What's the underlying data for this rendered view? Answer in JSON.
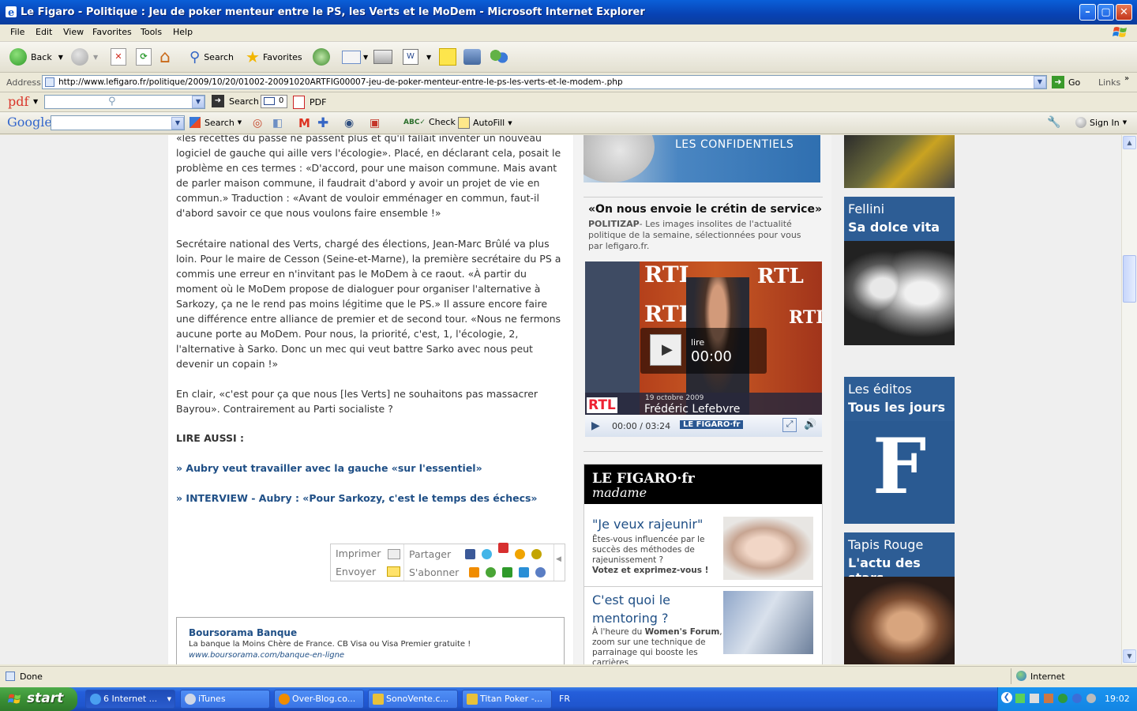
{
  "window": {
    "title": "Le Figaro - Politique : Jeu de poker menteur entre le PS, les Verts et le MoDem - Microsoft Internet Explorer"
  },
  "menu": [
    "File",
    "Edit",
    "View",
    "Favorites",
    "Tools",
    "Help"
  ],
  "toolbar": {
    "back": "Back",
    "search": "Search",
    "favorites": "Favorites"
  },
  "address": {
    "label": "Address",
    "url": "http://www.lefigaro.fr/politique/2009/10/20/01002-20091020ARTFIG00007-jeu-de-poker-menteur-entre-le-ps-les-verts-et-le-modem-.php",
    "go": "Go",
    "links": "Links"
  },
  "pdfbar": {
    "logo": "pdf",
    "search": "Search",
    "count": "0",
    "pdf": "PDF"
  },
  "googlebar": {
    "logo": "Google",
    "search": "Search",
    "check": "Check",
    "autofill": "AutoFill",
    "signin": "Sign In"
  },
  "article": {
    "p1": "«les recettes du passé ne passent plus et qu'il fallait inventer un nouveau logiciel de gauche qui aille vers l'écologie». Placé, en déclarant cela, posait le problème en ces termes : «D'accord, pour une maison commune. Mais avant de parler maison commune, il faudrait d'abord y avoir un projet de vie en commun.» Traduction : «Avant de vouloir emménager en commun, faut-il d'abord savoir ce que nous voulons faire ensemble !»",
    "p2": "Secrétaire national des Verts, chargé des élections, Jean-Marc Brûlé va plus loin. Pour le maire de Cesson (Seine-et-Marne), la première secrétaire du PS a commis une erreur en n'invitant pas le MoDem à ce raout. «À partir du moment où le MoDem propose de dialoguer pour organiser l'alternative à Sarkozy, ça ne le rend pas moins légitime que le PS.» Il assure encore faire une différence entre alliance de premier et de second tour. «Nous ne fermons aucune porte au MoDem. Pour nous, la priorité, c'est, 1, l'écologie, 2, l'alternative à Sarko. Donc un mec qui veut battre Sarko avec nous peut devenir un copain !»",
    "p3": "En clair, «c'est pour ça que nous [les Verts] ne souhaitons pas massacrer Bayrou». Contrairement au Parti socialiste ?",
    "lire_aussi": "LIRE AUSSI :",
    "link1": "» Aubry veut travailler avec la gauche «sur l'essentiel»",
    "link2": "» INTERVIEW - Aubry : «Pour Sarkozy, c'est le temps des échecs»",
    "share": {
      "imprimer": "Imprimer",
      "envoyer": "Envoyer",
      "partager": "Partager",
      "sabonner": "S'abonner"
    },
    "ad": {
      "title": "Boursorama Banque",
      "text": "La banque la Moins Chère de France. CB Visa ou Visa Premier gratuite !",
      "url": "www.boursorama.com/banque-en-ligne"
    }
  },
  "sidebar": {
    "confidentiels": "LES CONFIDENTIELS",
    "politizap_title": "«On nous envoie le crétin de service»",
    "politizap_kicker": "POLITIZAP",
    "politizap_text": "- Les images insolites de l'actualité politique de la semaine, sélectionnées pour vous par lefigaro.fr.",
    "video": {
      "lire": "lire",
      "time_overlay": "00:00",
      "rtl": "RTL",
      "date": "19 octobre 2009",
      "name": "Frédéric Lefebvre",
      "time": "00:00 / 03:24",
      "brand": "LE FIGARO·fr"
    },
    "madame": {
      "logo": "LE FIGARO·fr",
      "sub": "madame",
      "item1_title": "\"Je veux rajeunir\"",
      "item1_text": "Êtes-vous influencée par le succès des méthodes de rajeunissement ?",
      "item1_cta": "Votez et exprimez-vous !",
      "item2_title": "C'est quoi le mentoring ?",
      "item2_text_a": "À l'heure du ",
      "item2_bold": "Women's Forum",
      "item2_text_b": ", zoom sur une technique de parrainage qui booste les carrières"
    }
  },
  "farcol": {
    "promo1_line1": "Fellini",
    "promo1_line2": "Sa dolce vita",
    "promo2_line1": "Les éditos",
    "promo2_line2": "Tous les jours",
    "promo3_line1": "Tapis Rouge",
    "promo3_line2": "L'actu des stars"
  },
  "status": {
    "text": "Done",
    "zone": "Internet"
  },
  "taskbar": {
    "start": "start",
    "tasks": [
      "6 Internet ...",
      "iTunes",
      "Over-Blog.co...",
      "SonoVente.c...",
      "Titan Poker -..."
    ],
    "lang": "FR",
    "clock": "19:02"
  },
  "colors": {
    "link": "#1f4f86",
    "promo_blue": "#2d5d95",
    "xp_blue": "#0842b3",
    "start_green": "#3a8f35"
  }
}
